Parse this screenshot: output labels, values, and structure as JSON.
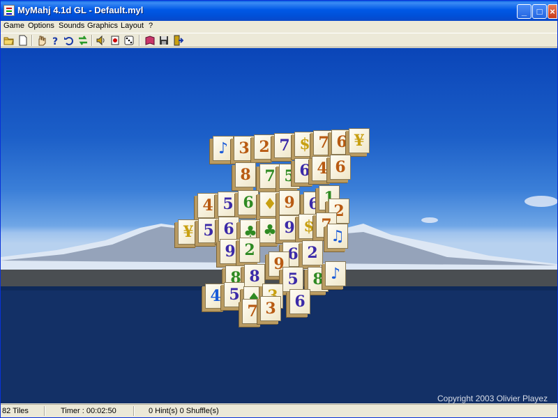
{
  "window": {
    "title": "MyMahj 4.1d GL - Default.myl"
  },
  "menu": [
    "Game",
    "Options",
    "Sounds",
    "Graphics",
    "Layout",
    "?"
  ],
  "toolbar": [
    {
      "icon": "open-folder-icon"
    },
    {
      "icon": "new-game-icon"
    },
    {
      "icon": "hand-icon"
    },
    {
      "icon": "hint-icon"
    },
    {
      "icon": "undo-icon"
    },
    {
      "icon": "shuffle-icon"
    },
    {
      "icon": "sound-icon"
    },
    {
      "icon": "tiles-icon"
    },
    {
      "icon": "dice-icon"
    },
    {
      "icon": "book-icon"
    },
    {
      "icon": "save-icon"
    },
    {
      "icon": "exit-icon"
    }
  ],
  "board": {
    "copyright": "Copyright 2003 Olivier Playez",
    "tiles": [
      "♪",
      "3",
      "2",
      "7",
      "$",
      "7",
      "6",
      "¥",
      "8",
      "7",
      "5",
      "6",
      "4",
      "6",
      "4",
      "5",
      "6",
      "♦",
      "9",
      "6",
      "1",
      "2",
      "¥",
      "5",
      "6",
      "♣",
      "♣",
      "9",
      "$",
      "7",
      "♫",
      "9",
      "2",
      "6",
      "2",
      "9",
      "8",
      "8",
      "5",
      "8",
      "♪",
      "4",
      "5",
      "♦",
      "3",
      "6",
      "7",
      "3"
    ]
  },
  "status": {
    "tiles": "82 Tiles",
    "timer": "Timer : 00:02:50",
    "hints": "0 Hint(s) 0 Shuffle(s)"
  },
  "colors": {
    "title_bar": "#0058e6",
    "sky": "#1c5fc8",
    "water": "#0f2a5a"
  }
}
